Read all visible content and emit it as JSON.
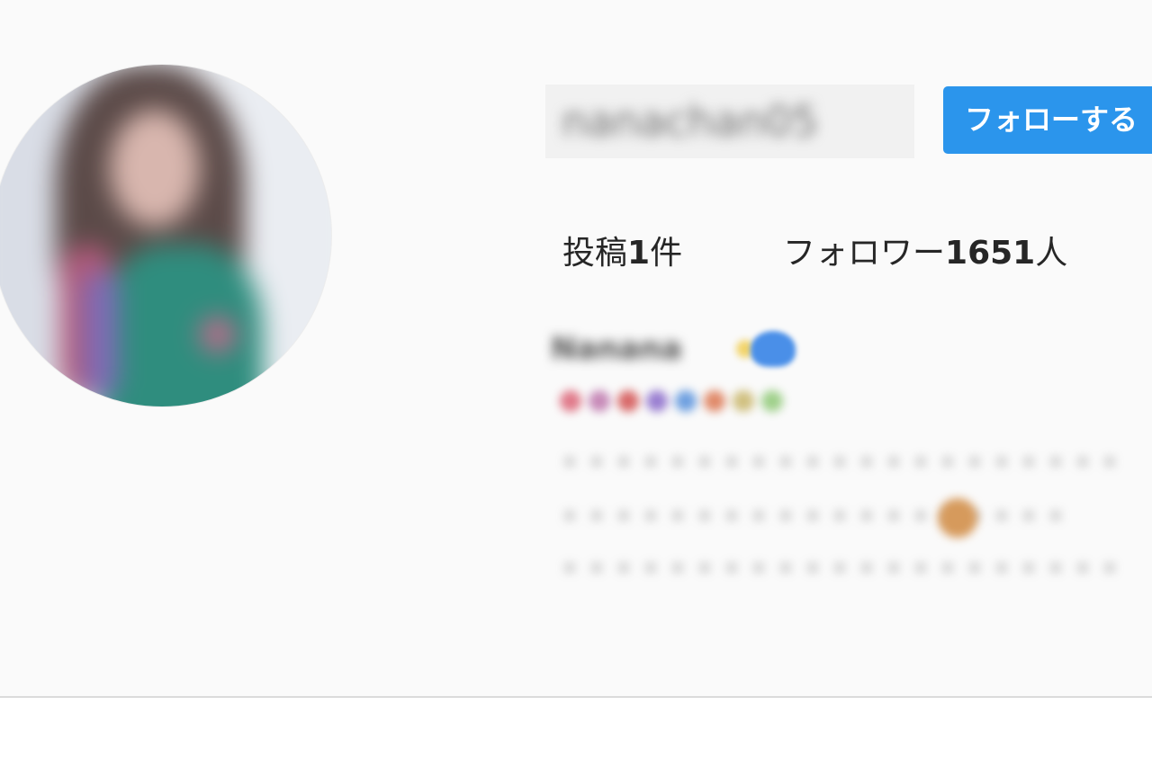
{
  "profile": {
    "username": "nanachan05",
    "follow_button_label": "フォローする",
    "stats": {
      "posts_label": "投稿",
      "posts_count": "1",
      "posts_suffix": "件",
      "followers_label": "フォロワー",
      "followers_count": "1651",
      "followers_suffix": "人"
    },
    "bio": {
      "name": "Nanana",
      "line1": "・・・・・・・・・・・・・・・・・・・・・",
      "line2": "・・・・・・・・・・・・・・・・・・・",
      "line3": "・・・・・・・・・・・・・・・・・・・・・"
    }
  },
  "colors": {
    "follow_button_bg": "#2b95ec",
    "page_bg": "#fafafa",
    "divider": "#dbdbdb",
    "text": "#262626"
  },
  "icons": {
    "bio_heart": "blue-heart-icon",
    "bio_sparkle": "sparkle-icon",
    "bio_emoji": "face-emoji-icon"
  }
}
